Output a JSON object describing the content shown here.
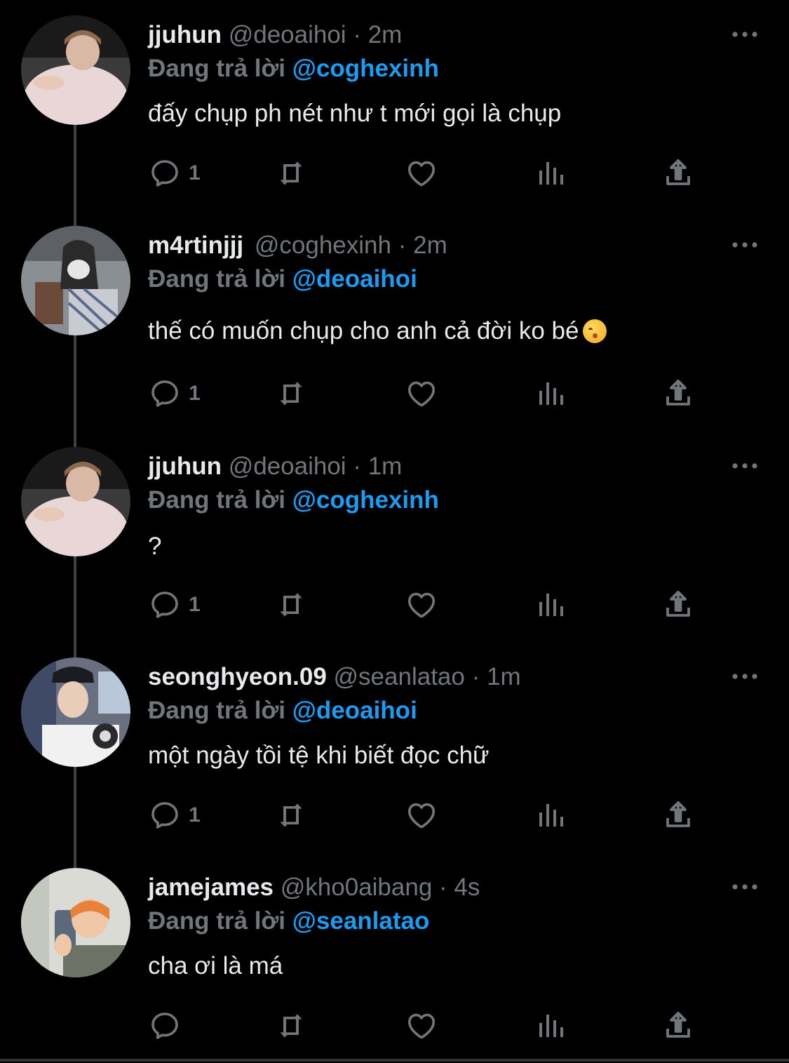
{
  "colors": {
    "background": "#000000",
    "text": "#e7e9ea",
    "muted": "#71767b",
    "accent": "#1d9bf0",
    "thread_line": "#3e4144"
  },
  "reply_prefix": "Đang trả lời",
  "icons": [
    "more-icon",
    "reply-icon",
    "retweet-icon",
    "like-icon",
    "views-icon",
    "share-icon"
  ],
  "tweets": [
    {
      "name": "jjuhun",
      "handle": "@deoaihoi",
      "time": "2m",
      "reply_to": "@coghexinh",
      "text": "đấy chụp ph nét như t mới gọi là chụp",
      "reply_count": "1"
    },
    {
      "name": "m4rtinjjj",
      "handle": "@coghexinh",
      "time": "2m",
      "reply_to": "@deoaihoi",
      "text": "thế có muốn chụp cho anh cả đời ko bé",
      "reply_count": "1"
    },
    {
      "name": "jjuhun",
      "handle": "@deoaihoi",
      "time": "1m",
      "reply_to": "@coghexinh",
      "text": "?",
      "reply_count": "1"
    },
    {
      "name": "seonghyeon.09",
      "handle": "@seanlatao",
      "time": "1m",
      "reply_to": "@deoaihoi",
      "text": "một ngày tồi tệ khi biết đọc chữ",
      "reply_count": "1"
    },
    {
      "name": "jamejames",
      "handle": "@kho0aibang",
      "time": "4s",
      "reply_to": "@seanlatao",
      "text": "cha ơi là má",
      "reply_count": ""
    }
  ]
}
